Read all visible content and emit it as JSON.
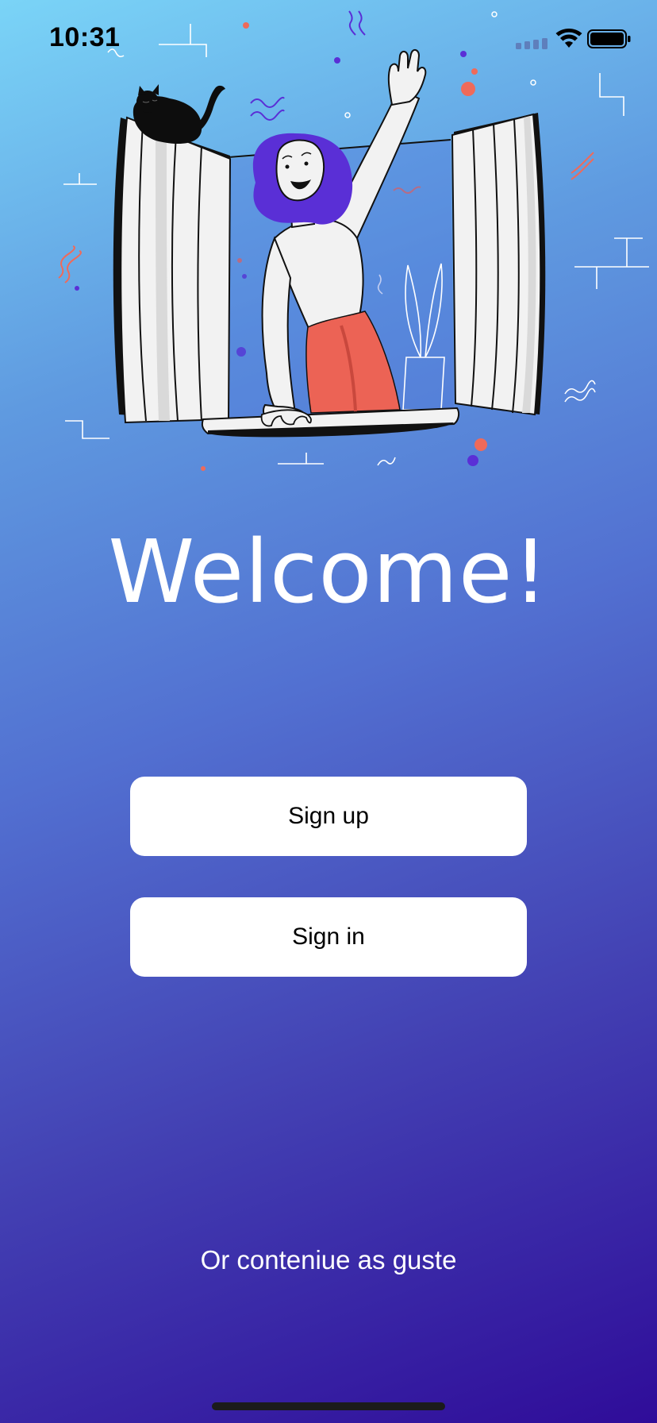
{
  "status_bar": {
    "time": "10:31",
    "icons": [
      "signal-icon",
      "wifi-icon",
      "battery-icon"
    ]
  },
  "illustration": {
    "subject": "woman-waving-from-window-illustration"
  },
  "welcome": {
    "title": "Welcome!"
  },
  "buttons": {
    "sign_up_label": "Sign up",
    "sign_in_label": "Sign in"
  },
  "guest": {
    "label": "Or conteniue as guste"
  },
  "colors": {
    "gradient_top": "#7ad4f7",
    "gradient_bottom": "#2f0c99",
    "button_bg": "#ffffff",
    "hair": "#5a2fd6",
    "skirt": "#ec6355",
    "accent_dot": "#ef6a5a"
  }
}
